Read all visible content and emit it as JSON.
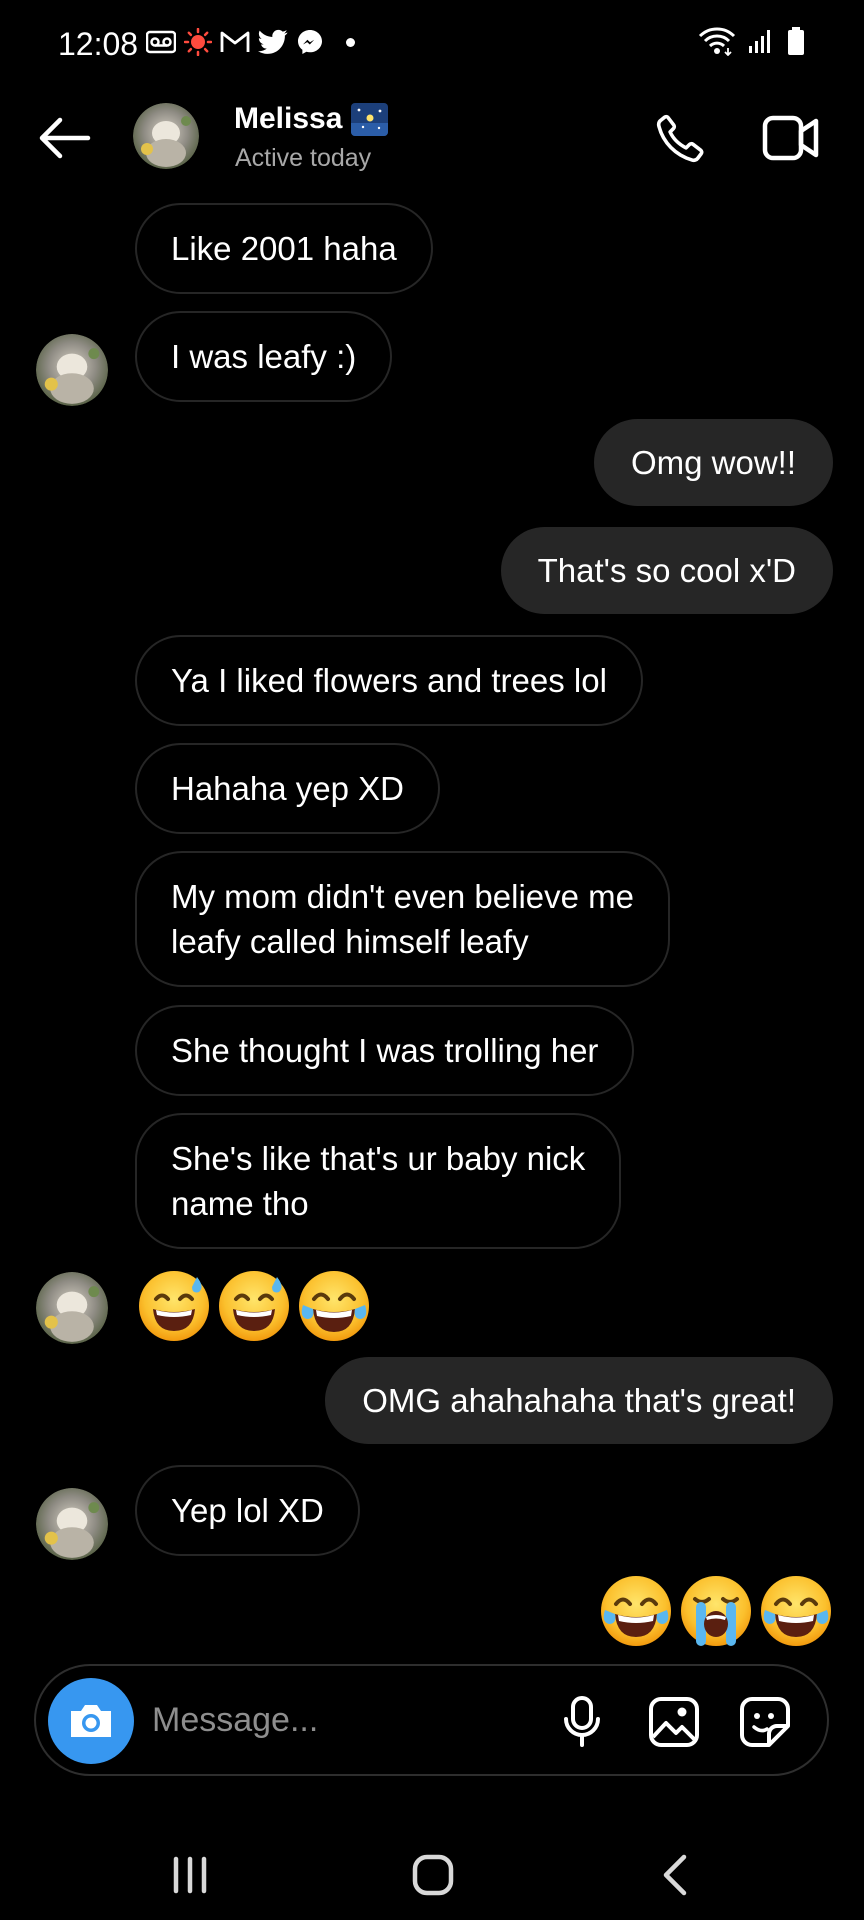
{
  "status_bar": {
    "time": "12:08",
    "left_icons": [
      "voicemail-icon",
      "screen-recorder-icon",
      "gmail-icon",
      "twitter-icon",
      "messenger-icon",
      "notification-dot-icon"
    ],
    "right_icons": [
      "wifi-icon",
      "signal-icon",
      "battery-icon"
    ]
  },
  "header": {
    "contact_name": "Melissa",
    "contact_status": "Active today",
    "icons": [
      "back-arrow-icon",
      "phone-icon",
      "video-camera-icon"
    ]
  },
  "messages": [
    {
      "side": "in",
      "text": "Like 2001 haha"
    },
    {
      "side": "in",
      "text": "I was leafy :)",
      "avatar": true
    },
    {
      "side": "out",
      "text": "Omg wow!!"
    },
    {
      "side": "out",
      "text": "That's so cool x'D"
    },
    {
      "side": "in",
      "text": "Ya I liked flowers and trees lol"
    },
    {
      "side": "in",
      "text": "Hahaha yep XD"
    },
    {
      "side": "in",
      "lines": [
        "My mom didn't even believe me",
        "leafy called himself leafy"
      ]
    },
    {
      "side": "in",
      "text": "She thought I was trolling her"
    },
    {
      "side": "in",
      "lines": [
        "She's like that's ur baby nick",
        "name tho"
      ]
    },
    {
      "side": "in",
      "emojis": [
        "grinning-sweat-emoji",
        "grinning-sweat-emoji",
        "tears-of-joy-emoji"
      ],
      "avatar": true
    },
    {
      "side": "out",
      "text": "OMG ahahahaha that's great!"
    },
    {
      "side": "in",
      "text": "Yep lol XD",
      "avatar": true
    },
    {
      "side": "out",
      "emojis": [
        "tears-of-joy-emoji",
        "loudly-crying-emoji",
        "tears-of-joy-emoji"
      ]
    }
  ],
  "composer": {
    "placeholder": "Message...",
    "icons": [
      "camera-icon",
      "microphone-icon",
      "gallery-icon",
      "sticker-icon"
    ]
  },
  "nav_bar": {
    "icons": [
      "recents-icon",
      "home-icon",
      "nav-back-icon"
    ]
  },
  "colors": {
    "background": "#000000",
    "outgoing_bubble": "#262626",
    "incoming_border": "#262626",
    "camera_button": "#3797f0",
    "secondary_text": "#a8a8a8"
  }
}
